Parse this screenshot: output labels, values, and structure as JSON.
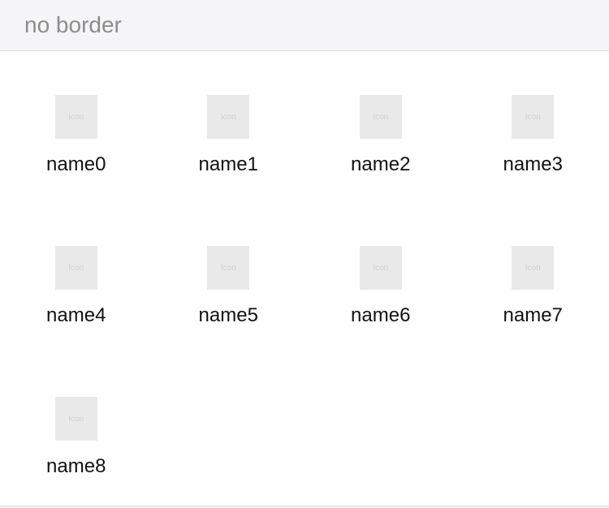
{
  "header": {
    "title": "no border"
  },
  "grid": {
    "items": [
      {
        "icon_text": "Icon",
        "label": "name0"
      },
      {
        "icon_text": "Icon",
        "label": "name1"
      },
      {
        "icon_text": "Icon",
        "label": "name2"
      },
      {
        "icon_text": "Icon",
        "label": "name3"
      },
      {
        "icon_text": "Icon",
        "label": "name4"
      },
      {
        "icon_text": "Icon",
        "label": "name5"
      },
      {
        "icon_text": "Icon",
        "label": "name6"
      },
      {
        "icon_text": "Icon",
        "label": "name7"
      },
      {
        "icon_text": "Icon",
        "label": "name8"
      }
    ]
  },
  "colors": {
    "page_background": "#f5f5f7",
    "panel_background": "#ffffff",
    "icon_placeholder": "#e9e9e9",
    "header_text": "#8c8c8c",
    "label_text": "#111111"
  }
}
